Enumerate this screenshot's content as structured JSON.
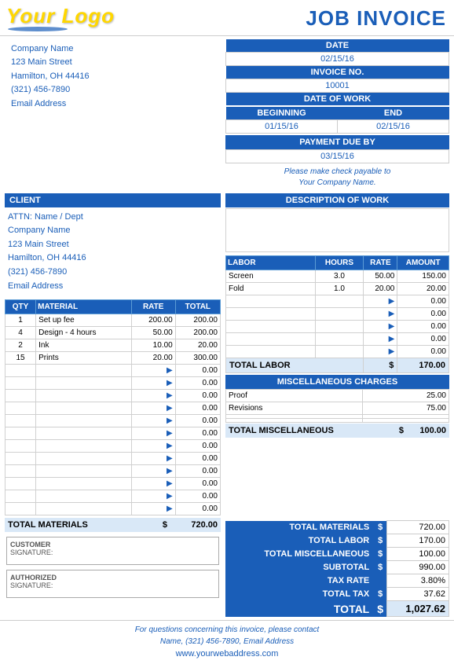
{
  "header": {
    "logo_text": "Your Logo",
    "invoice_title": "JOB INVOICE"
  },
  "company": {
    "name": "Company Name",
    "street": "123 Main Street",
    "city_state": "Hamilton, OH  44416",
    "phone": "(321) 456-7890",
    "email": "Email Address"
  },
  "client": {
    "header": "CLIENT",
    "attn": "ATTN: Name / Dept",
    "name": "Company Name",
    "street": "123 Main Street",
    "city_state": "Hamilton, OH  44416",
    "phone": "(321) 456-7890",
    "email": "Email Address"
  },
  "date_section": {
    "date_label": "DATE",
    "date_value": "02/15/16",
    "invoice_no_label": "INVOICE NO.",
    "invoice_no_value": "10001",
    "date_of_work_label": "DATE OF WORK",
    "beginning_label": "BEGINNING",
    "end_label": "END",
    "beginning_value": "01/15/16",
    "end_value": "02/15/16",
    "payment_due_label": "PAYMENT DUE BY",
    "payment_due_value": "03/15/16",
    "check_payable_line1": "Please make check payable to",
    "check_payable_line2": "Your Company Name."
  },
  "materials": {
    "headers": [
      "QTY",
      "MATERIAL",
      "RATE",
      "TOTAL"
    ],
    "rows": [
      {
        "qty": "1",
        "material": "Set up fee",
        "rate": "200.00",
        "total": "200.00"
      },
      {
        "qty": "4",
        "material": "Design - 4 hours",
        "rate": "50.00",
        "total": "200.00"
      },
      {
        "qty": "2",
        "material": "Ink",
        "rate": "10.00",
        "total": "20.00"
      },
      {
        "qty": "15",
        "material": "Prints",
        "rate": "20.00",
        "total": "300.00"
      }
    ],
    "empty_rows": 12,
    "total_label": "TOTAL MATERIALS",
    "total_dollar": "$",
    "total_value": "720.00"
  },
  "description_of_work": {
    "header": "DESCRIPTION OF WORK"
  },
  "labor": {
    "headers": [
      "LABOR",
      "HOURS",
      "RATE",
      "AMOUNT"
    ],
    "rows": [
      {
        "labor": "Screen",
        "hours": "3.0",
        "rate": "50.00",
        "amount": "150.00"
      },
      {
        "labor": "Fold",
        "hours": "1.0",
        "rate": "20.00",
        "amount": "20.00"
      },
      {
        "labor": "",
        "hours": "",
        "rate": "",
        "amount": "0.00"
      },
      {
        "labor": "",
        "hours": "",
        "rate": "",
        "amount": "0.00"
      },
      {
        "labor": "",
        "hours": "",
        "rate": "",
        "amount": "0.00"
      },
      {
        "labor": "",
        "hours": "",
        "rate": "",
        "amount": "0.00"
      },
      {
        "labor": "",
        "hours": "",
        "rate": "",
        "amount": "0.00"
      }
    ],
    "total_label": "TOTAL LABOR",
    "total_dollar": "$",
    "total_value": "170.00"
  },
  "misc": {
    "header": "MISCELLANEOUS CHARGES",
    "rows": [
      {
        "description": "Proof",
        "amount": "25.00"
      },
      {
        "description": "Revisions",
        "amount": "75.00"
      },
      {
        "description": "",
        "amount": ""
      },
      {
        "description": "",
        "amount": ""
      }
    ],
    "total_label": "TOTAL MISCELLANEOUS",
    "total_dollar": "$",
    "total_value": "100.00"
  },
  "summary": {
    "total_materials_label": "TOTAL MATERIALS",
    "total_materials_dollar": "$",
    "total_materials_value": "720.00",
    "total_labor_label": "TOTAL LABOR",
    "total_labor_dollar": "$",
    "total_labor_value": "170.00",
    "total_misc_label": "TOTAL MISCELLANEOUS",
    "total_misc_dollar": "$",
    "total_misc_value": "100.00",
    "subtotal_label": "SUBTOTAL",
    "subtotal_dollar": "$",
    "subtotal_value": "990.00",
    "tax_rate_label": "TAX RATE",
    "tax_rate_value": "3.80%",
    "total_tax_label": "TOTAL TAX",
    "total_tax_dollar": "$",
    "total_tax_value": "37.62",
    "total_label": "TOTAL",
    "total_dollar": "$",
    "total_value": "1,027.62"
  },
  "signatures": {
    "customer_label": "CUSTOMER",
    "customer_sig_label": "SIGNATURE:",
    "authorized_label": "AUTHORIZED",
    "authorized_sig_label": "SIGNATURE:"
  },
  "footer": {
    "contact_text": "For questions concerning this invoice, please contact",
    "contact_info": "Name, (321) 456-7890, Email Address",
    "website": "www.yourwebaddress.com"
  }
}
